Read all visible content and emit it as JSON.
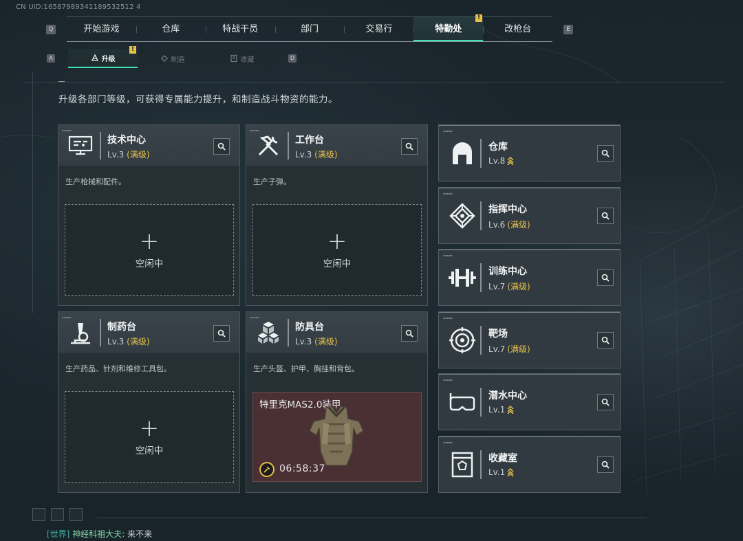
{
  "uid": "CN UID:16587989341189532512 4",
  "nav": {
    "left_key": "Q",
    "right_key": "E",
    "tabs": [
      "开始游戏",
      "仓库",
      "特战干员",
      "部门",
      "交易行",
      "特勤处",
      "改枪台"
    ],
    "active": "特勤处",
    "alert_badge": "!"
  },
  "subnav": {
    "left_key": "A",
    "right_key": "D",
    "tabs": [
      "升级",
      "制造",
      "收藏"
    ],
    "active": "升级",
    "alert_badge": "!"
  },
  "intro": "升级各部门等级，可获得专属能力提升，和制造战斗物资的能力。",
  "workstations": [
    {
      "name": "技术中心",
      "level": "Lv.3",
      "max": "(满级)",
      "desc": "生产枪械和配件。",
      "status": "空闲中",
      "icon": "computer-icon"
    },
    {
      "name": "工作台",
      "level": "Lv.3",
      "max": "(满级)",
      "desc": "生产子弹。",
      "status": "空闲中",
      "icon": "tools-icon"
    },
    {
      "name": "制药台",
      "level": "Lv.3",
      "max": "(满级)",
      "desc": "生产药品、针剂和维修工具包。",
      "status": "空闲中",
      "icon": "microscope-icon"
    },
    {
      "name": "防具台",
      "level": "Lv.3",
      "max": "(满级)",
      "desc": "生产头盔、护甲、胸挂和背包。",
      "icon": "cubes-icon",
      "crafting": {
        "item": "特里克MAS2.0装甲",
        "timer": "06:58:37",
        "icon": "armor-vest-icon"
      }
    }
  ],
  "departments": [
    {
      "name": "仓库",
      "level": "Lv.8",
      "max": "",
      "upgradable": true,
      "icon": "warehouse-icon"
    },
    {
      "name": "指挥中心",
      "level": "Lv.6",
      "max": "(满级)",
      "upgradable": false,
      "icon": "command-icon"
    },
    {
      "name": "训练中心",
      "level": "Lv.7",
      "max": "(满级)",
      "upgradable": false,
      "icon": "dumbbell-icon"
    },
    {
      "name": "靶场",
      "level": "Lv.7",
      "max": "(满级)",
      "upgradable": false,
      "icon": "target-icon"
    },
    {
      "name": "潜水中心",
      "level": "Lv.1",
      "max": "",
      "upgradable": true,
      "icon": "diving-mask-icon"
    },
    {
      "name": "收藏室",
      "level": "Lv.1",
      "max": "",
      "upgradable": true,
      "icon": "collection-icon"
    }
  ],
  "plus_glyph": "+",
  "chat": {
    "channel": "[世界]",
    "sender": "神经科祖大夫:",
    "message": "来不来"
  },
  "colors": {
    "accent": "#3fe0b4",
    "gold": "#e8c14a",
    "craft_bg": "#4a2f33"
  }
}
